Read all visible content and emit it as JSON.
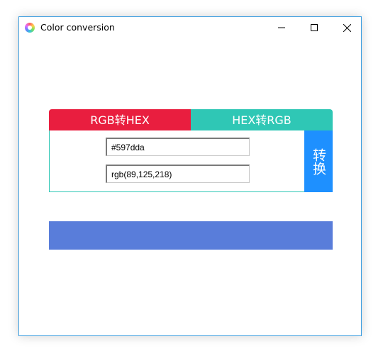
{
  "window": {
    "title": "Color conversion"
  },
  "tabs": [
    {
      "label": "RGB转HEX",
      "color": "#e91e3f"
    },
    {
      "label": "HEX转RGB",
      "color": "#2fc7b5"
    }
  ],
  "inputs": {
    "hex_value": "#597dda",
    "rgb_value": "rgb(89,125,218)"
  },
  "convert_button": {
    "label": "转换",
    "color": "#1e90ff"
  },
  "preview": {
    "color": "#597dda"
  },
  "icons": {
    "app": "color-wheel-icon",
    "minimize": "minimize-icon",
    "maximize": "maximize-icon",
    "close": "close-icon"
  }
}
